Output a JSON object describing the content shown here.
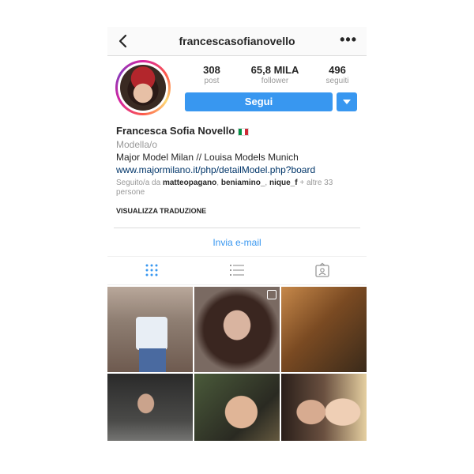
{
  "header": {
    "username": "francescasofianovello",
    "back_icon": "chevron-left-icon",
    "more_label": "•••"
  },
  "stats": [
    {
      "value": "308",
      "label": "post"
    },
    {
      "value": "65,8 MILA",
      "label": "follower"
    },
    {
      "value": "496",
      "label": "seguiti"
    }
  ],
  "actions": {
    "follow_label": "Segui",
    "accent_color": "#3897f0"
  },
  "profile": {
    "name": "Francesca Sofia Novello",
    "category": "Modella/o",
    "bio": "Major Model Milan // Louisa Models Munich",
    "link": "www.majormilano.it/php/detailModel.php?board",
    "followed_by_prefix": "Seguito/a da ",
    "followed_by_users": [
      "matteopagano",
      "beniamino_",
      "nique_f"
    ],
    "followed_by_suffix": " + altre 33 persone",
    "translate_label": "VISUALIZZA TRADUZIONE"
  },
  "email_label": "Invia e-mail",
  "tabs": [
    {
      "icon": "grid-icon"
    },
    {
      "icon": "list-icon"
    },
    {
      "icon": "tagged-icon"
    }
  ]
}
